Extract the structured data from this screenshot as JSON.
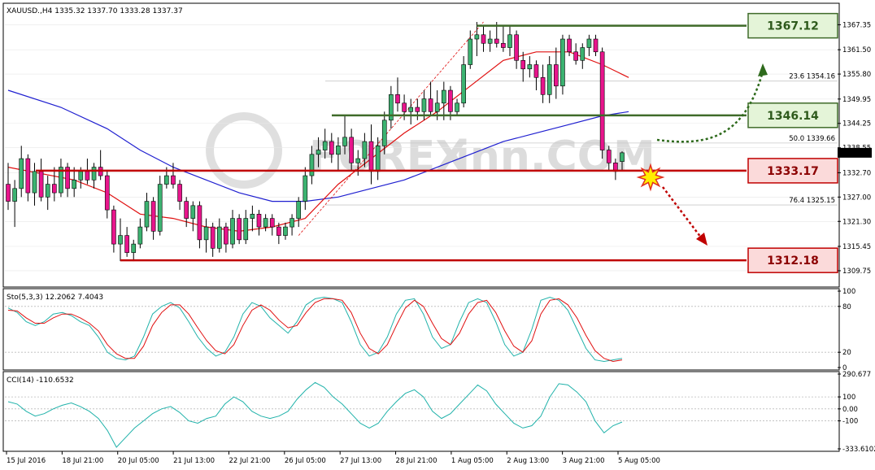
{
  "chart_data": [
    {
      "type": "candlestick",
      "title": "XAUUSD.,H4  1335.32 1337.70 1333.28 1337.37",
      "ylim": [
        1306.5,
        1372
      ],
      "y_ticks": [
        "1367.35",
        "1361.50",
        "1355.80",
        "1349.95",
        "1344.25",
        "1338.55",
        "1332.70",
        "1327.00",
        "1321.30",
        "1315.45",
        "1309.75"
      ],
      "current_price": "1337.37",
      "x_labels": [
        "15 Jul 2016",
        "18 Jul 21:00",
        "20 Jul 05:00",
        "21 Jul 13:00",
        "22 Jul 21:00",
        "26 Jul 05:00",
        "27 Jul 13:00",
        "28 Jul 21:00",
        "1 Aug 05:00",
        "2 Aug 13:00",
        "3 Aug 21:00",
        "5 Aug 05:00"
      ],
      "candles": [
        [
          1330,
          1335,
          1324,
          1326
        ],
        [
          1326,
          1331,
          1320,
          1329
        ],
        [
          1329,
          1339,
          1327,
          1336
        ],
        [
          1336,
          1337,
          1326,
          1328
        ],
        [
          1328,
          1335,
          1325,
          1333
        ],
        [
          1333,
          1336,
          1326,
          1327
        ],
        [
          1327,
          1332,
          1324,
          1330
        ],
        [
          1330,
          1334,
          1326,
          1328
        ],
        [
          1328,
          1336,
          1327,
          1334
        ],
        [
          1334,
          1335,
          1327,
          1329
        ],
        [
          1329,
          1334,
          1327,
          1331
        ],
        [
          1331,
          1334,
          1329,
          1333
        ],
        [
          1333,
          1336,
          1330,
          1331
        ],
        [
          1331,
          1335,
          1329,
          1334
        ],
        [
          1334,
          1338,
          1331,
          1332
        ],
        [
          1332,
          1333,
          1322,
          1324
        ],
        [
          1324,
          1325,
          1314,
          1316
        ],
        [
          1316,
          1322,
          1312,
          1318
        ],
        [
          1318,
          1320,
          1313,
          1314
        ],
        [
          1314,
          1317,
          1312,
          1316
        ],
        [
          1316,
          1322,
          1315,
          1320
        ],
        [
          1320,
          1328,
          1319,
          1326
        ],
        [
          1326,
          1327,
          1317,
          1319
        ],
        [
          1319,
          1332,
          1318,
          1330
        ],
        [
          1330,
          1334,
          1329,
          1332
        ],
        [
          1332,
          1335,
          1329,
          1330
        ],
        [
          1330,
          1331,
          1324,
          1326
        ],
        [
          1326,
          1327,
          1320,
          1322
        ],
        [
          1322,
          1326,
          1319,
          1325
        ],
        [
          1325,
          1326,
          1315,
          1317
        ],
        [
          1317,
          1322,
          1314,
          1320
        ],
        [
          1320,
          1321,
          1313,
          1315
        ],
        [
          1315,
          1322,
          1314,
          1320
        ],
        [
          1320,
          1321,
          1314,
          1316
        ],
        [
          1316,
          1324,
          1315,
          1322
        ],
        [
          1322,
          1323,
          1316,
          1317
        ],
        [
          1317,
          1324,
          1316,
          1322
        ],
        [
          1322,
          1325,
          1319,
          1323
        ],
        [
          1323,
          1324,
          1318,
          1320
        ],
        [
          1320,
          1323,
          1319,
          1322
        ],
        [
          1322,
          1323,
          1318,
          1320
        ],
        [
          1320,
          1321,
          1316,
          1318
        ],
        [
          1318,
          1321,
          1317,
          1320
        ],
        [
          1320,
          1323,
          1318,
          1322
        ],
        [
          1322,
          1327,
          1320,
          1326
        ],
        [
          1326,
          1334,
          1324,
          1332
        ],
        [
          1332,
          1339,
          1330,
          1337
        ],
        [
          1337,
          1341,
          1334,
          1338
        ],
        [
          1338,
          1343,
          1336,
          1340
        ],
        [
          1340,
          1342,
          1335,
          1337
        ],
        [
          1337,
          1341,
          1333,
          1339
        ],
        [
          1339,
          1346,
          1337,
          1341
        ],
        [
          1341,
          1343,
          1333,
          1335
        ],
        [
          1335,
          1338,
          1332,
          1336
        ],
        [
          1336,
          1342,
          1334,
          1340
        ],
        [
          1340,
          1344,
          1330,
          1333
        ],
        [
          1333,
          1341,
          1331,
          1339
        ],
        [
          1339,
          1347,
          1337,
          1345
        ],
        [
          1345,
          1353,
          1343,
          1351
        ],
        [
          1351,
          1355,
          1347,
          1349
        ],
        [
          1349,
          1351,
          1345,
          1347
        ],
        [
          1347,
          1350,
          1344,
          1348
        ],
        [
          1348,
          1350,
          1345,
          1347
        ],
        [
          1347,
          1352,
          1345,
          1350
        ],
        [
          1350,
          1354,
          1346,
          1347
        ],
        [
          1347,
          1352,
          1345,
          1349
        ],
        [
          1349,
          1354,
          1345,
          1352
        ],
        [
          1352,
          1353,
          1345,
          1347
        ],
        [
          1347,
          1350,
          1346,
          1349
        ],
        [
          1349,
          1360,
          1348,
          1358
        ],
        [
          1358,
          1366,
          1357,
          1364
        ],
        [
          1364,
          1368,
          1360,
          1365
        ],
        [
          1365,
          1367,
          1361,
          1363
        ],
        [
          1363,
          1366,
          1361,
          1364
        ],
        [
          1364,
          1368,
          1362,
          1363
        ],
        [
          1363,
          1367,
          1361,
          1362
        ],
        [
          1362,
          1367,
          1360,
          1365
        ],
        [
          1365,
          1366,
          1357,
          1359
        ],
        [
          1359,
          1361,
          1354,
          1357
        ],
        [
          1357,
          1360,
          1355,
          1358
        ],
        [
          1358,
          1359,
          1352,
          1355
        ],
        [
          1355,
          1358,
          1349,
          1351
        ],
        [
          1351,
          1360,
          1349,
          1358
        ],
        [
          1358,
          1362,
          1350,
          1353
        ],
        [
          1353,
          1365,
          1351,
          1364
        ],
        [
          1364,
          1365,
          1360,
          1361
        ],
        [
          1361,
          1363,
          1358,
          1359
        ],
        [
          1359,
          1363,
          1357,
          1362
        ],
        [
          1362,
          1365,
          1360,
          1364
        ],
        [
          1364,
          1365,
          1360,
          1361
        ],
        [
          1361,
          1362,
          1336,
          1338
        ],
        [
          1338,
          1339,
          1333,
          1335
        ],
        [
          1335,
          1336,
          1331,
          1333
        ],
        [
          1335.32,
          1337.7,
          1333.28,
          1337.37
        ]
      ],
      "ma_fast": [
        [
          0,
          1334
        ],
        [
          10,
          1331
        ],
        [
          15,
          1328
        ],
        [
          20,
          1323
        ],
        [
          25,
          1322
        ],
        [
          30,
          1320
        ],
        [
          35,
          1319
        ],
        [
          40,
          1320
        ],
        [
          45,
          1322
        ],
        [
          50,
          1330
        ],
        [
          55,
          1336
        ],
        [
          60,
          1342
        ],
        [
          65,
          1347
        ],
        [
          70,
          1353
        ],
        [
          75,
          1359
        ],
        [
          80,
          1361
        ],
        [
          85,
          1361
        ],
        [
          90,
          1358
        ],
        [
          94,
          1355
        ]
      ],
      "ma_slow": [
        [
          0,
          1352
        ],
        [
          8,
          1348
        ],
        [
          15,
          1343
        ],
        [
          20,
          1338
        ],
        [
          25,
          1334
        ],
        [
          30,
          1331
        ],
        [
          35,
          1328
        ],
        [
          40,
          1326
        ],
        [
          45,
          1326
        ],
        [
          50,
          1327
        ],
        [
          55,
          1329
        ],
        [
          60,
          1331
        ],
        [
          65,
          1334
        ],
        [
          70,
          1337
        ],
        [
          75,
          1340
        ],
        [
          80,
          1342
        ],
        [
          85,
          1344
        ],
        [
          90,
          1346
        ],
        [
          94,
          1347
        ]
      ],
      "fib_levels": [
        {
          "label": "23.6 1354.16",
          "y": 1354.16
        },
        {
          "label": "50.0 1339.66",
          "y": 1339.66
        },
        {
          "label": "76.4 1325.15",
          "y": 1325.15
        }
      ],
      "levels": [
        {
          "value": 1367.12,
          "text": "1367.12",
          "kind": "resistance",
          "color": "#3f6b2a"
        },
        {
          "value": 1346.14,
          "text": "1346.14",
          "kind": "resistance",
          "color": "#3f6b2a"
        },
        {
          "value": 1333.17,
          "text": "1333.17",
          "kind": "support",
          "color": "#c00000"
        },
        {
          "value": 1312.18,
          "text": "1312.18",
          "kind": "support",
          "color": "#c00000"
        }
      ]
    },
    {
      "type": "line",
      "title": "Sto(5,3,3) 12.2062 7.4043",
      "ylim": [
        0,
        100
      ],
      "y_ticks": [
        "100",
        "80",
        "20",
        "0"
      ],
      "series": [
        {
          "color": "#20b2aa",
          "values": [
            78,
            72,
            60,
            55,
            60,
            70,
            72,
            68,
            60,
            55,
            40,
            20,
            12,
            10,
            15,
            40,
            70,
            80,
            85,
            78,
            60,
            40,
            25,
            15,
            20,
            40,
            70,
            85,
            80,
            65,
            55,
            45,
            60,
            82,
            90,
            92,
            90,
            85,
            60,
            30,
            15,
            20,
            40,
            70,
            88,
            90,
            70,
            40,
            25,
            30,
            60,
            85,
            90,
            85,
            60,
            30,
            15,
            20,
            50,
            88,
            92,
            88,
            75,
            50,
            25,
            10,
            8,
            10,
            12
          ]
        },
        {
          "color": "#e01010",
          "values": [
            75,
            74,
            65,
            58,
            58,
            65,
            70,
            70,
            65,
            58,
            48,
            30,
            18,
            12,
            12,
            28,
            55,
            72,
            82,
            82,
            70,
            52,
            35,
            22,
            18,
            30,
            55,
            75,
            82,
            75,
            62,
            52,
            55,
            72,
            85,
            90,
            90,
            88,
            72,
            45,
            25,
            18,
            30,
            55,
            78,
            88,
            80,
            58,
            38,
            30,
            45,
            70,
            85,
            88,
            72,
            48,
            28,
            20,
            35,
            70,
            88,
            90,
            82,
            65,
            42,
            22,
            12,
            8,
            10
          ]
        }
      ]
    },
    {
      "type": "line",
      "title": "CCI(14) -110.6532",
      "ylim": [
        -333.6102,
        290.677
      ],
      "y_ticks": [
        "290.677",
        "100",
        "0.00",
        "-100",
        "-333.6102"
      ],
      "series": [
        {
          "color": "#20b2aa",
          "values": [
            60,
            40,
            -20,
            -60,
            -40,
            0,
            30,
            50,
            20,
            -20,
            -80,
            -180,
            -320,
            -240,
            -160,
            -100,
            -40,
            0,
            20,
            -30,
            -100,
            -120,
            -80,
            -60,
            40,
            100,
            60,
            -20,
            -60,
            -80,
            -60,
            -20,
            80,
            160,
            220,
            180,
            100,
            40,
            -40,
            -120,
            -160,
            -120,
            -20,
            60,
            130,
            160,
            100,
            -20,
            -80,
            -40,
            40,
            120,
            200,
            150,
            40,
            -40,
            -120,
            -160,
            -140,
            -60,
            100,
            210,
            200,
            140,
            60,
            -100,
            -200,
            -140,
            -110
          ]
        }
      ]
    }
  ]
}
